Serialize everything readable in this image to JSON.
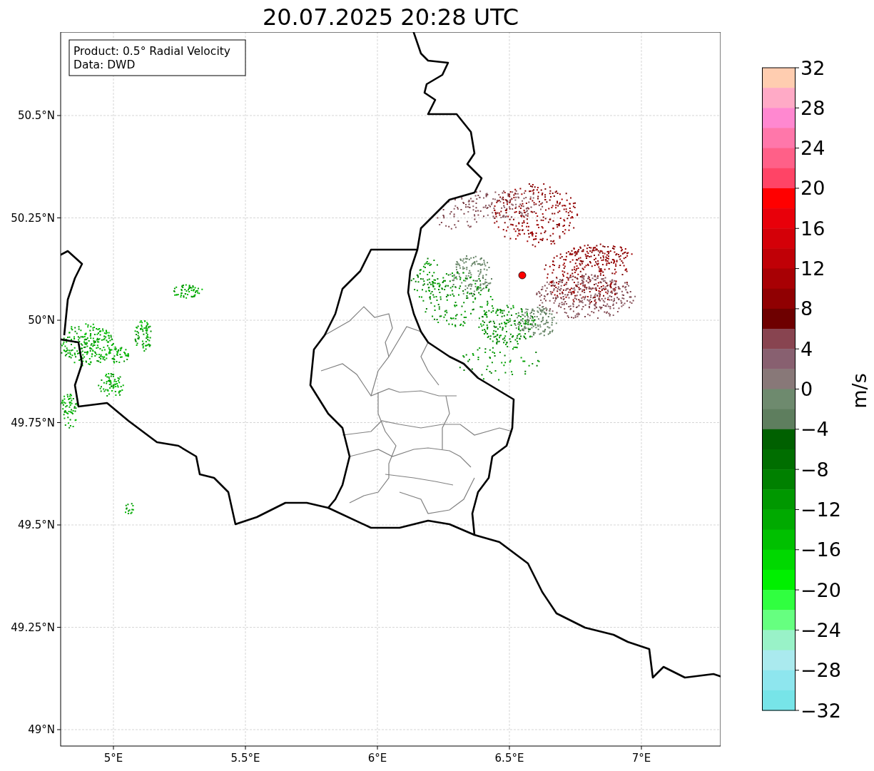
{
  "title": "20.07.2025 20:28 UTC",
  "info_box": [
    "Product: 0.5° Radial Velocity",
    "Data: DWD"
  ],
  "map": {
    "lat_labels": [
      "50.5°N",
      "50.25°N",
      "50°N",
      "49.75°N",
      "49.5°N",
      "49.25°N",
      "49°N"
    ],
    "lon_labels": [
      "5°E",
      "5.5°E",
      "6°E",
      "6.5°E",
      "7°E"
    ]
  },
  "colorbar": {
    "unit": "m/s",
    "ticks": [
      "32",
      "28",
      "24",
      "20",
      "16",
      "12",
      "8",
      "4",
      "0",
      "−4",
      "−8",
      "−12",
      "−16",
      "−20",
      "−24",
      "−28",
      "−32"
    ],
    "bins": [
      {
        "color": "#ffcdb0"
      },
      {
        "color": "#ffaac6"
      },
      {
        "color": "#ff88d0"
      },
      {
        "color": "#ff77aa"
      },
      {
        "color": "#ff6088"
      },
      {
        "color": "#ff4466"
      },
      {
        "color": "#ff0000"
      },
      {
        "color": "#e8000a"
      },
      {
        "color": "#d40008"
      },
      {
        "color": "#c00006"
      },
      {
        "color": "#a80004"
      },
      {
        "color": "#900002"
      },
      {
        "color": "#6e0000"
      },
      {
        "color": "#884450"
      },
      {
        "color": "#886070"
      },
      {
        "color": "#887878"
      },
      {
        "color": "#6e8a6e"
      },
      {
        "color": "#5e7e5e"
      },
      {
        "color": "#006000"
      },
      {
        "color": "#006e00"
      },
      {
        "color": "#008000"
      },
      {
        "color": "#009800"
      },
      {
        "color": "#00aa00"
      },
      {
        "color": "#00c000"
      },
      {
        "color": "#00d800"
      },
      {
        "color": "#00f000"
      },
      {
        "color": "#30ff40"
      },
      {
        "color": "#66ff80"
      },
      {
        "color": "#99f2c8"
      },
      {
        "color": "#aaeaee"
      },
      {
        "color": "#8ee6ee"
      },
      {
        "color": "#77e4e8"
      }
    ]
  }
}
